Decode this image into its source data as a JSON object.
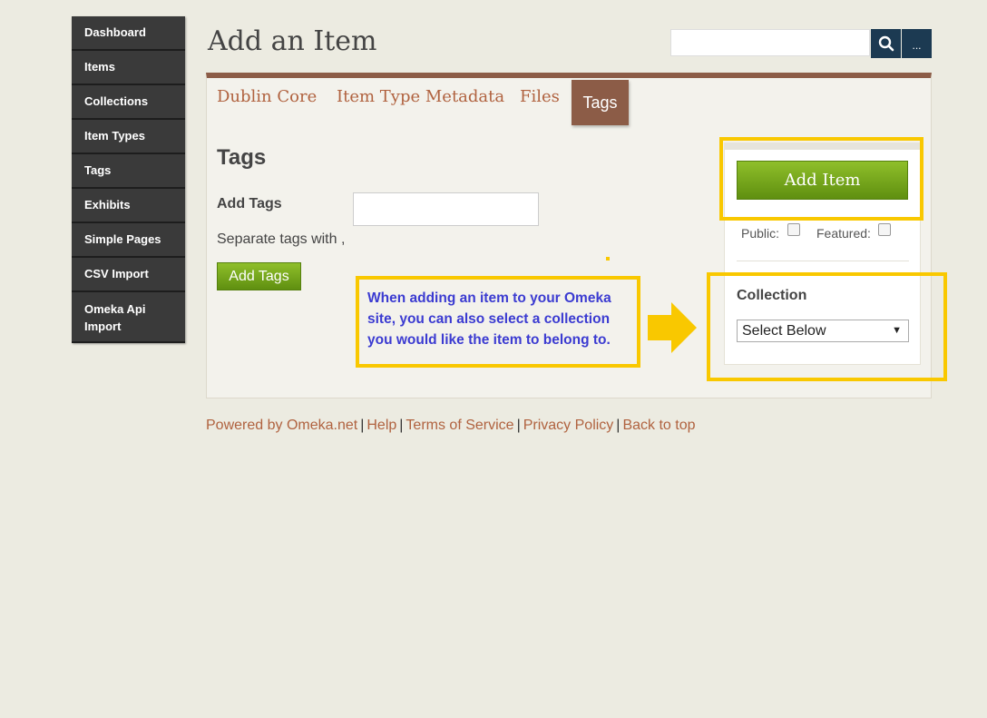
{
  "nav": {
    "items": [
      {
        "label": "Dashboard"
      },
      {
        "label": "Items"
      },
      {
        "label": "Collections"
      },
      {
        "label": "Item Types"
      },
      {
        "label": "Tags"
      },
      {
        "label": "Exhibits"
      },
      {
        "label": "Simple Pages"
      },
      {
        "label": "CSV Import"
      },
      {
        "label": "Omeka Api Import"
      }
    ]
  },
  "header": {
    "title": "Add an Item",
    "search_value": "",
    "advanced_label": "..."
  },
  "tabs": [
    {
      "label": "Dublin Core"
    },
    {
      "label": "Item Type Metadata"
    },
    {
      "label": "Files"
    },
    {
      "label": "Tags",
      "active": true
    }
  ],
  "tags_section": {
    "heading": "Tags",
    "add_tags_label": "Add Tags",
    "input_value": "",
    "separator_hint": "Separate tags with ,",
    "add_tags_button": "Add Tags"
  },
  "callout": {
    "text": "When adding an item to your Omeka site, you can also select a collection you would like the item to belong to."
  },
  "sidebar_panel": {
    "add_item_button": "Add Item",
    "public_label": "Public:",
    "public_checked": false,
    "featured_label": "Featured:",
    "featured_checked": false,
    "collection_label": "Collection",
    "collection_selected": "Select Below"
  },
  "footer": {
    "powered_by": "Powered by Omeka.net",
    "help": "Help",
    "terms": "Terms of Service",
    "privacy": "Privacy Policy",
    "back_to_top": "Back to top"
  },
  "colors": {
    "nav_bg": "#3a3a3a",
    "accent_brown": "#8c5c47",
    "link": "#b0623f",
    "button_green": "#7aaa1e",
    "search_blue": "#1c3a52",
    "highlight_yellow": "#f9c800",
    "callout_text": "#3b3bd1"
  },
  "icons": {
    "search": "search-icon",
    "arrow": "right-arrow-icon",
    "caret": "dropdown-caret-icon"
  }
}
